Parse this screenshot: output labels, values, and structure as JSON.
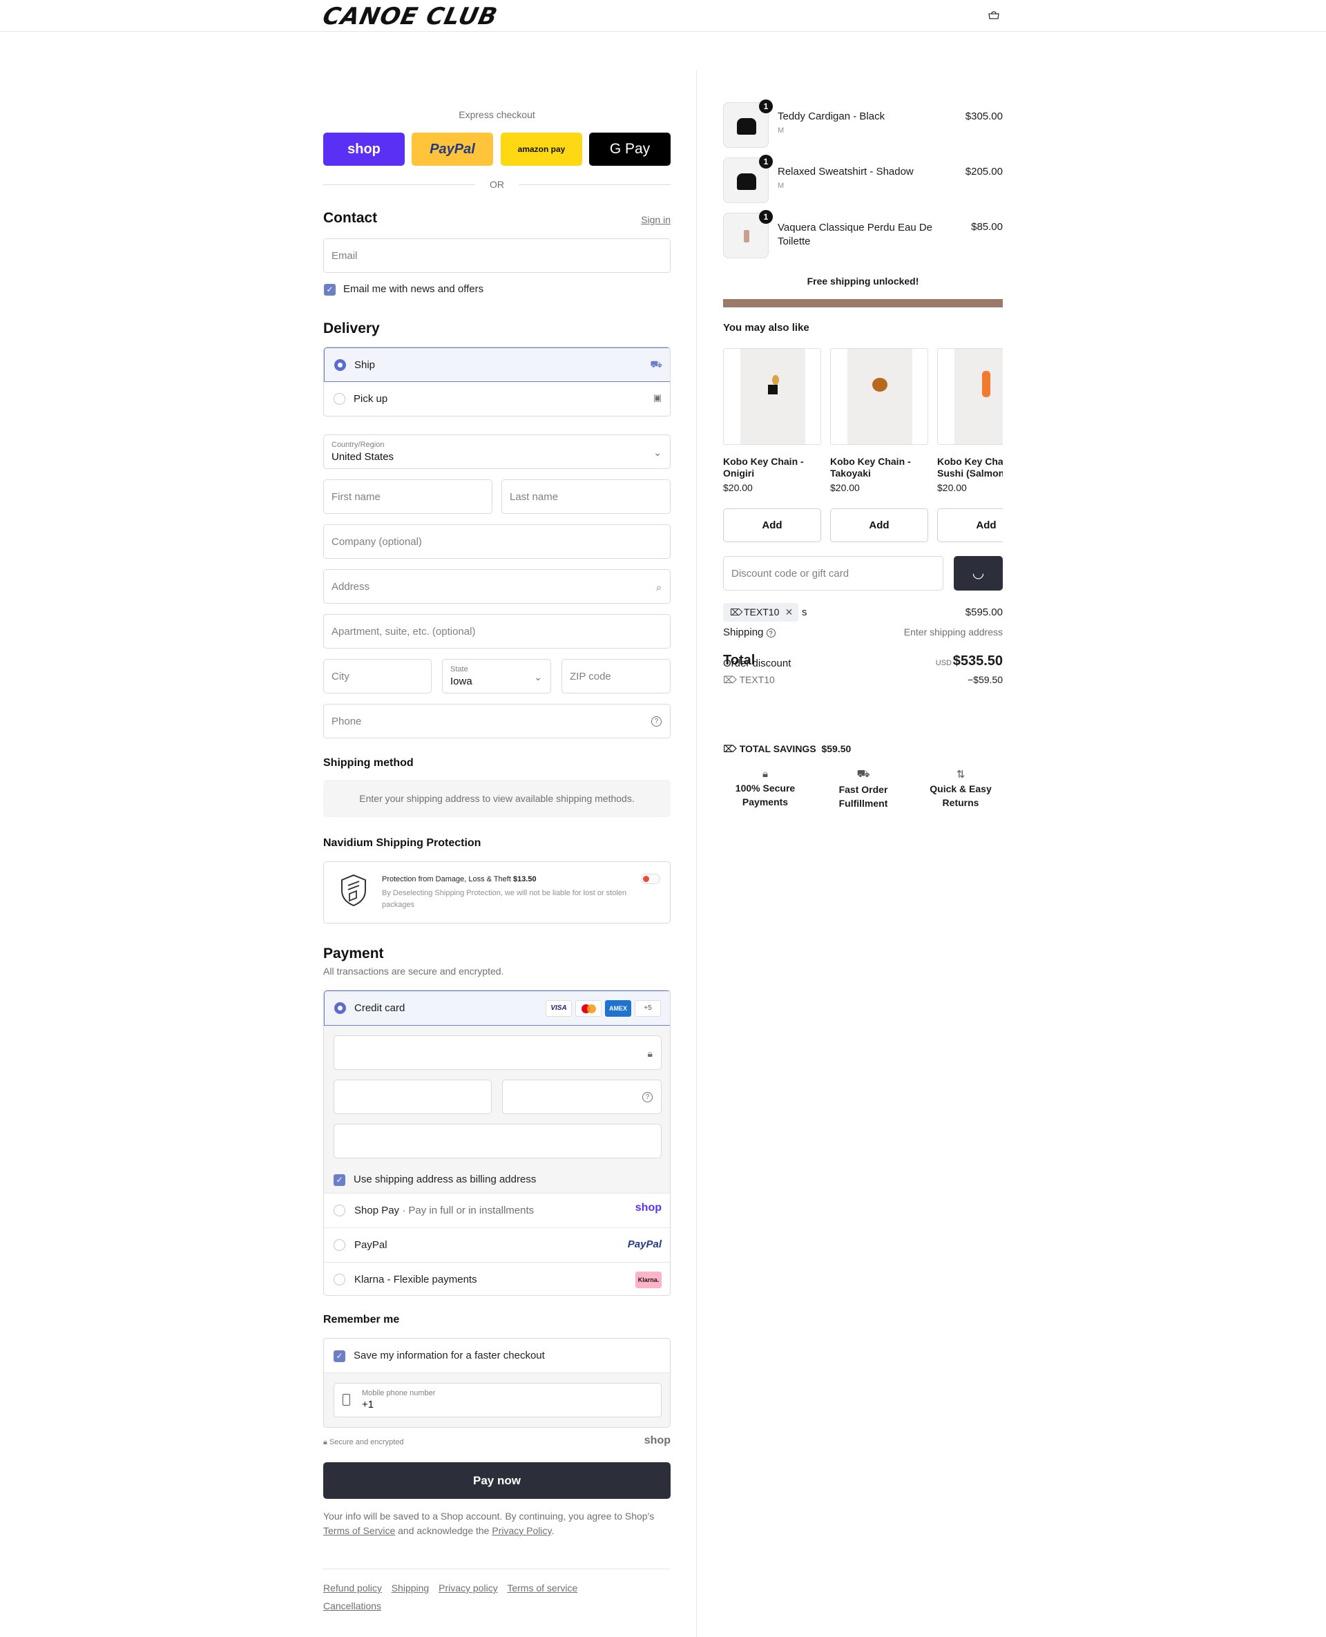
{
  "header": {
    "logo": "CANOE CLUB",
    "cart_icon": "bag-icon"
  },
  "express": {
    "title": "Express checkout",
    "buttons": [
      {
        "label": "shop",
        "color": "#5a31f4"
      },
      {
        "label": "PayPal",
        "color": "#ffc439"
      },
      {
        "label": "amazon pay",
        "color": "#ffd814"
      },
      {
        "label": "G Pay",
        "color": "#000000"
      }
    ],
    "or": "OR"
  },
  "contact": {
    "title": "Contact",
    "sign_in": "Sign in",
    "email_placeholder": "Email",
    "newsletter_label": "Email me with news and offers"
  },
  "delivery": {
    "title": "Delivery",
    "options": [
      {
        "label": "Ship"
      },
      {
        "label": "Pick up"
      }
    ],
    "country_label": "Country/Region",
    "country_value": "United States",
    "first_name": "First name",
    "last_name": "Last name",
    "company": "Company (optional)",
    "address": "Address",
    "apartment": "Apartment, suite, etc. (optional)",
    "city": "City",
    "state_label": "State",
    "state_value": "Iowa",
    "zip": "ZIP code",
    "phone": "Phone"
  },
  "shipping_method": {
    "title": "Shipping method",
    "notice": "Enter your shipping address to view available shipping methods."
  },
  "protection": {
    "title": "Navidium Shipping Protection",
    "line1": "Protection from Damage, Loss & Theft",
    "price": "$13.50",
    "line2": "By Deselecting Shipping Protection, we will not be liable for lost or stolen packages"
  },
  "payment": {
    "title": "Payment",
    "subtitle": "All transactions are secure and encrypted.",
    "credit_card": "Credit card",
    "card_logos": [
      "VISA",
      "MC",
      "AMEX",
      "+5"
    ],
    "billing_same": "Use shipping address as billing address",
    "shop_pay": "Shop Pay",
    "shop_pay_sub": "Pay in full or in installments",
    "shop_pay_logo": "shop",
    "paypal": "PayPal",
    "paypal_logo": "PayPal",
    "klarna": "Klarna - Flexible payments",
    "klarna_logo": "Klarna."
  },
  "remember": {
    "title": "Remember me",
    "save_label": "Save my information for a faster checkout",
    "mobile_label": "Mobile phone number",
    "mobile_value": "+1",
    "secure": "Secure and encrypted",
    "shop_logo": "shop"
  },
  "pay_now": "Pay now",
  "legal": {
    "prefix": "Your info will be saved to a Shop account. By continuing, you agree to Shop's",
    "terms": "Terms of Service",
    "mid": "and acknowledge the",
    "privacy": "Privacy Policy",
    "end": "."
  },
  "footer_links": [
    "Refund policy",
    "Shipping",
    "Privacy policy",
    "Terms of service",
    "Cancellations"
  ],
  "cart": {
    "items": [
      {
        "qty": "1",
        "name": "Teddy Cardigan - Black",
        "variant": "M",
        "price": "$305.00"
      },
      {
        "qty": "1",
        "name": "Relaxed Sweatshirt - Shadow",
        "variant": "M",
        "price": "$205.00"
      },
      {
        "qty": "1",
        "name": "Vaquera Classique Perdu Eau De Toilette",
        "variant": "",
        "price": "$85.00"
      }
    ],
    "free_shipping": "Free shipping unlocked!",
    "progress": 1.0,
    "progress_color": "#9b7a6a"
  },
  "upsell": {
    "title": "You may also like",
    "items": [
      {
        "name": "Kobo Key Chain - Onigiri",
        "price": "$20.00",
        "add": "Add"
      },
      {
        "name": "Kobo Key Chain - Takoyaki",
        "price": "$20.00",
        "add": "Add"
      },
      {
        "name": "Kobo Key Chain - Sushi (Salmon)",
        "price": "$20.00",
        "add": "Add"
      }
    ]
  },
  "discount": {
    "placeholder": "Discount code or gift card",
    "code": "TEXT10"
  },
  "summary": {
    "subtotal_suffix": "s",
    "subtotal": "$595.00",
    "shipping_label": "Shipping",
    "shipping_value": "Enter shipping address",
    "order_discount": "Order discount",
    "discount_code": "TEXT10",
    "discount_amount": "−$59.50",
    "total_label": "Total",
    "currency": "USD",
    "total": "$535.50"
  },
  "savings": {
    "label": "TOTAL SAVINGS",
    "amount": "$59.50"
  },
  "trust": [
    {
      "line1": "100% Secure",
      "line2": "Payments",
      "icon": "lock-icon"
    },
    {
      "line1": "Fast Order",
      "line2": "Fulfillment",
      "icon": "truck-icon"
    },
    {
      "line1": "Quick & Easy",
      "line2": "Returns",
      "icon": "arrows-icon"
    }
  ]
}
